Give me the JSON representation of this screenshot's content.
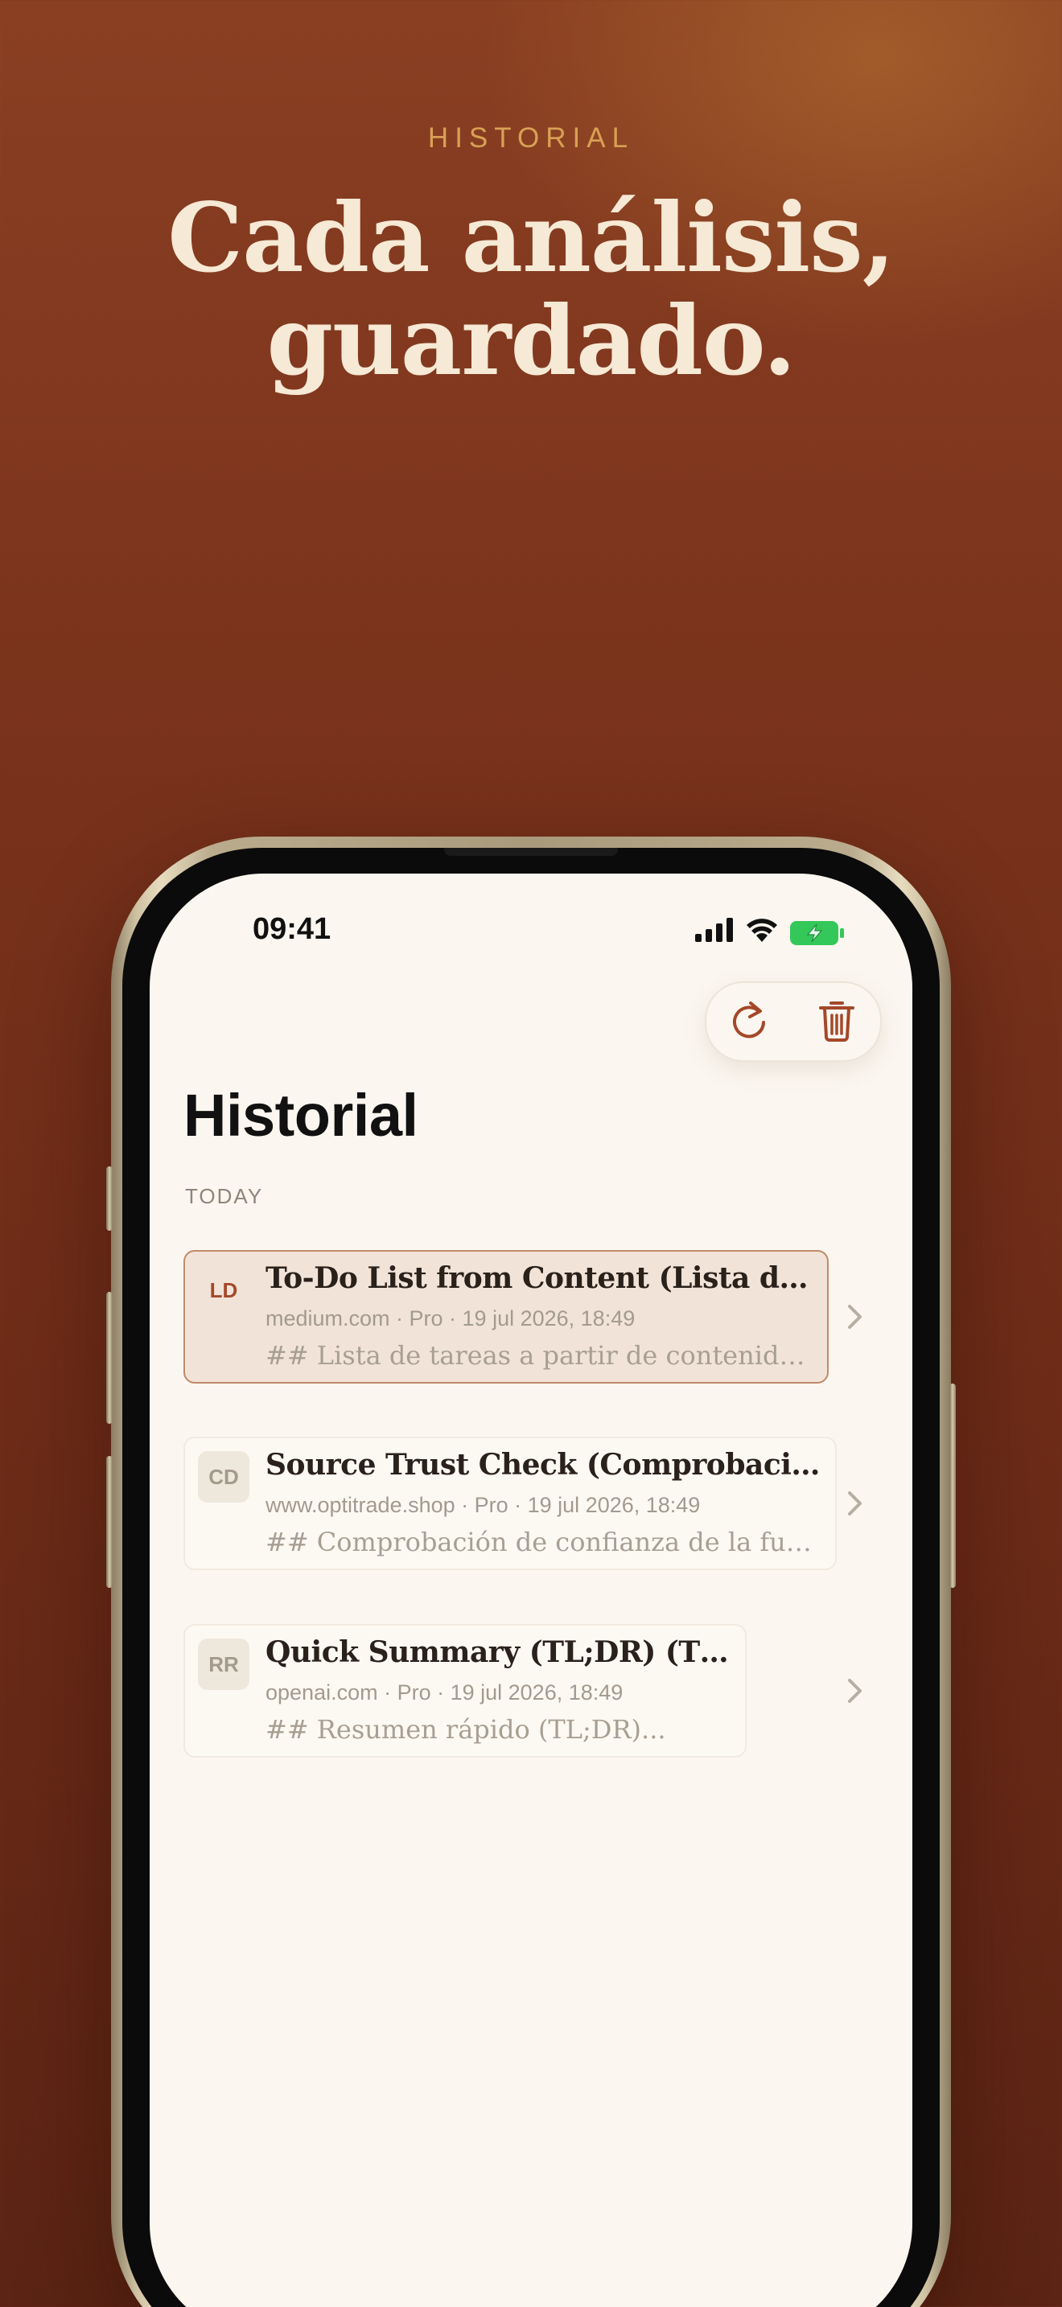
{
  "hero": {
    "eyebrow": "HISTORIAL",
    "headline_line1": "Cada análisis,",
    "headline_line2": "guardado."
  },
  "status_bar": {
    "time": "09:41",
    "icons": [
      "cellular-signal-icon",
      "wifi-icon",
      "battery-charging-icon"
    ]
  },
  "toolbar": {
    "refresh_icon": "refresh-icon",
    "delete_icon": "trash-icon"
  },
  "page": {
    "title": "Historial",
    "section": "TODAY"
  },
  "history": [
    {
      "initials": "LD",
      "title": "To-Do List from Content (Lista de tar...",
      "meta": "medium.com · Pro · 19 jul 2026, 18:49",
      "preview": "## Lista de tareas a partir de contenido...",
      "selected": true
    },
    {
      "initials": "CD",
      "title": "Source Trust Check (Comprobación d...",
      "meta": "www.optitrade.shop · Pro · 19 jul 2026, 18:49",
      "preview": "## Comprobación de confianza de la fuen...",
      "selected": false
    },
    {
      "initials": "RR",
      "title": "Quick Summary (TL;DR) (TL;DR)",
      "meta": "openai.com · Pro · 19 jul 2026, 18:49",
      "preview": "## Resumen rápido (TL;DR)...",
      "selected": false
    }
  ],
  "colors": {
    "background": "#7a331c",
    "eyebrow": "#d9a054",
    "headline": "#f6e9d5",
    "accent": "#a4482a",
    "battery_green": "#34c759"
  }
}
